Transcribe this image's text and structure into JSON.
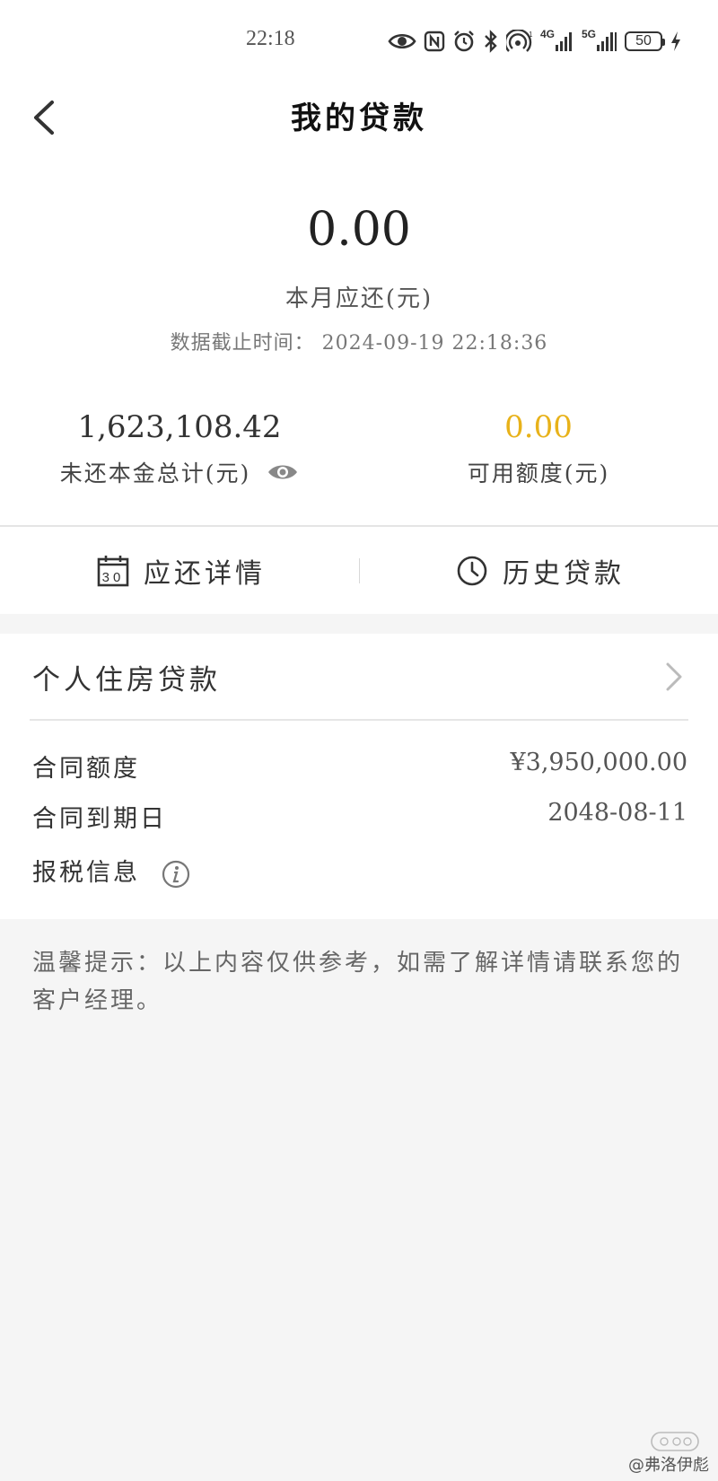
{
  "status_bar": {
    "time": "22:18",
    "signal_1_label": "4G",
    "signal_2_label": "5G",
    "battery_level": "50"
  },
  "header": {
    "title": "我的贷款"
  },
  "summary": {
    "due_amount": "0.00",
    "due_label": "本月应还(元)",
    "cutoff_text": "数据截止时间： 2024-09-19  22:18:36",
    "outstanding_value": "1,623,108.42",
    "outstanding_label": "未还本金总计(元)",
    "available_value": "0.00",
    "available_label": "可用额度(元)"
  },
  "actions": {
    "repayment_details": "应还详情",
    "history_loans": "历史贷款",
    "calendar_day": "30"
  },
  "loan": {
    "title": "个人住房贷款",
    "contract_amount_label": "合同额度",
    "contract_amount_value": "¥3,950,000.00",
    "maturity_label": "合同到期日",
    "maturity_value": "2048-08-11",
    "tax_info_label": "报税信息"
  },
  "tip": {
    "text": "温馨提示：以上内容仅供参考，如需了解详情请联系您的客户经理。"
  },
  "watermark": {
    "text": "@弗洛伊彪"
  },
  "colors": {
    "available_value": "#e8b21a",
    "page_bg": "#f5f5f5"
  }
}
